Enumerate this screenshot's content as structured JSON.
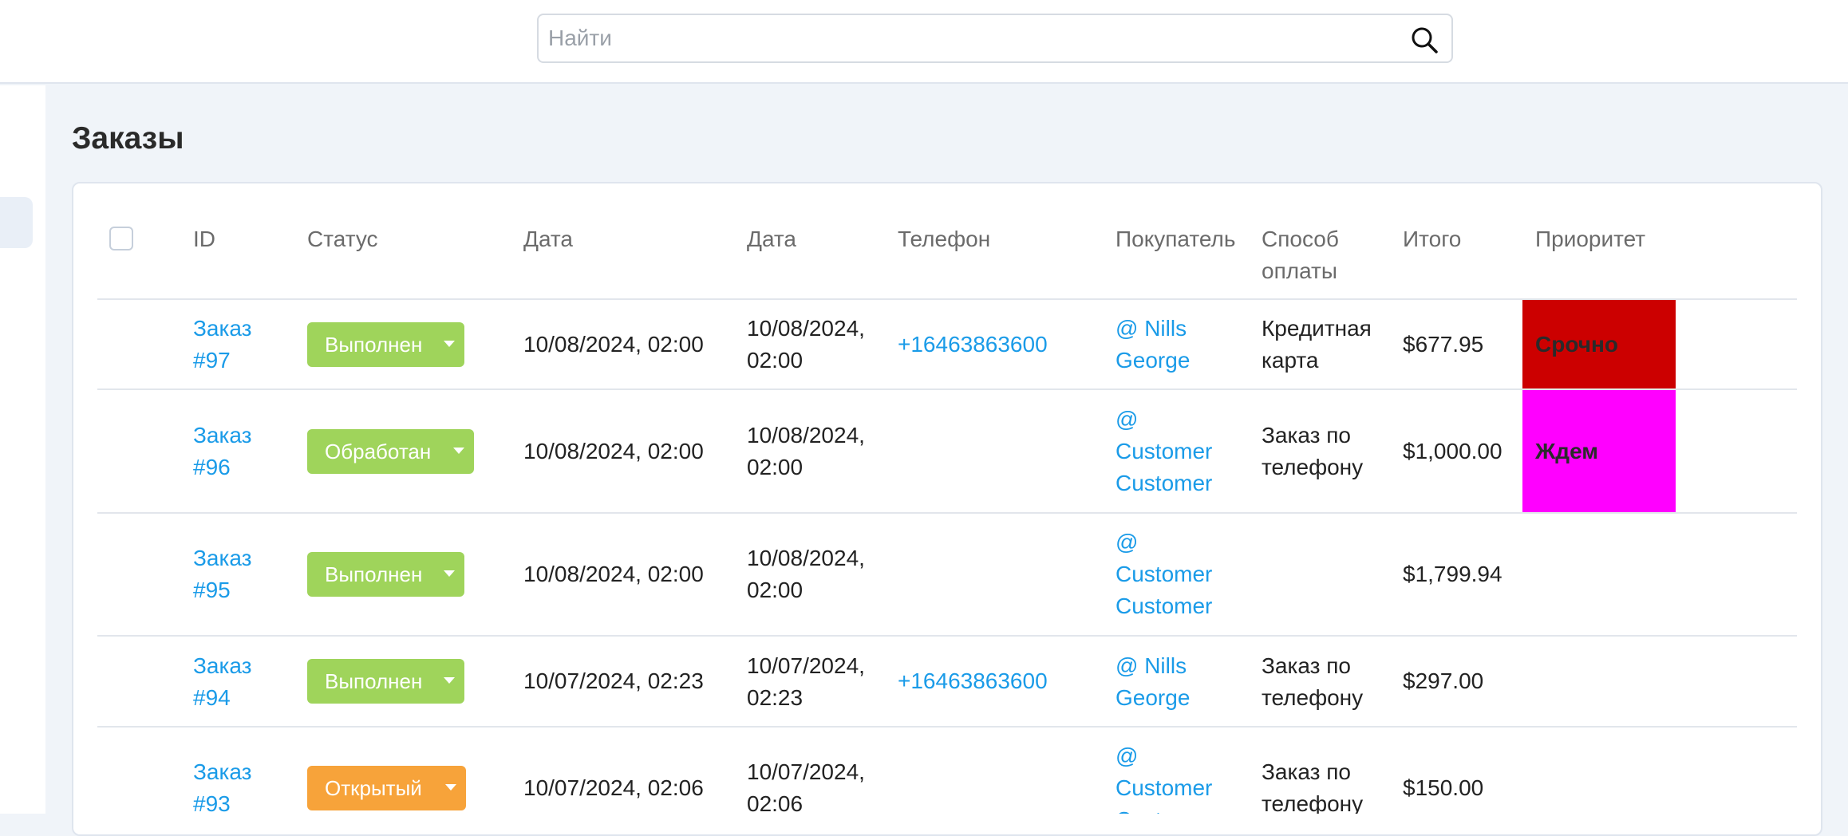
{
  "search": {
    "placeholder": "Найти"
  },
  "page": {
    "title": "Заказы"
  },
  "table": {
    "headers": {
      "id": "ID",
      "status": "Статус",
      "date1": "Дата",
      "date2": "Дата",
      "phone": "Телефон",
      "buyer": "Покупатель",
      "payment": "Способ оплаты",
      "total": "Итого",
      "priority": "Приоритет"
    },
    "rows": [
      {
        "id": "Заказ #97",
        "status": "Выполнен",
        "date1": "10/08/2024, 02:00",
        "date2": "10/08/2024, 02:00",
        "phone": "+16463863600",
        "buyer": "@ Nills George",
        "payment": "Кредитная карта",
        "total": "$677.95",
        "priority": "Срочно",
        "priority_color": "#cc0000",
        "status_color": "#9fd45b"
      },
      {
        "id": "Заказ #96",
        "status": "Обработан",
        "date1": "10/08/2024, 02:00",
        "date2": "10/08/2024, 02:00",
        "phone": "",
        "buyer": "@ Customer Customer",
        "payment": "Заказ по телефону",
        "total": "$1,000.00",
        "priority": "Ждем",
        "priority_color": "#ff00ff",
        "status_color": "#9fd45b"
      },
      {
        "id": "Заказ #95",
        "status": "Выполнен",
        "date1": "10/08/2024, 02:00",
        "date2": "10/08/2024, 02:00",
        "phone": "",
        "buyer": "@ Customer Customer",
        "payment": "",
        "total": "$1,799.94",
        "priority": "",
        "status_color": "#9fd45b"
      },
      {
        "id": "Заказ #94",
        "status": "Выполнен",
        "date1": "10/07/2024, 02:23",
        "date2": "10/07/2024, 02:23",
        "phone": "+16463863600",
        "buyer": "@ Nills George",
        "payment": "Заказ по телефону",
        "total": "$297.00",
        "priority": "",
        "status_color": "#9fd45b"
      },
      {
        "id": "Заказ #93",
        "status": "Открытый",
        "date1": "10/07/2024, 02:06",
        "date2": "10/07/2024, 02:06",
        "phone": "",
        "buyer": "@ Customer Customer",
        "payment": "Заказ по телефону",
        "total": "$150.00",
        "priority": "",
        "status_color": "#f7a33a"
      }
    ]
  }
}
